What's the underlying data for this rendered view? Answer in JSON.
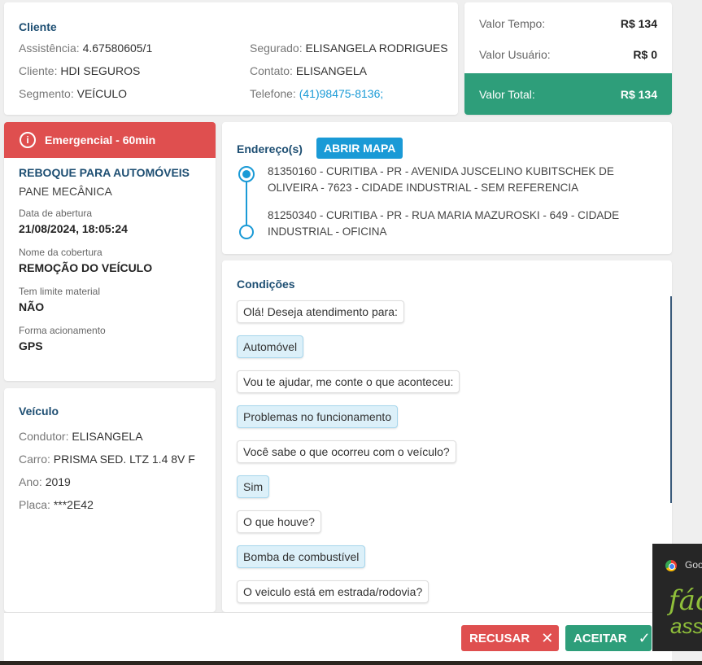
{
  "cliente": {
    "title": "Cliente",
    "assistencia_label": "Assistência:",
    "assistencia": "4.67580605/1",
    "cliente_label": "Cliente:",
    "cliente": "HDI SEGUROS",
    "segmento_label": "Segmento:",
    "segmento": "VEÍCULO",
    "segurado_label": "Segurado:",
    "segurado": "ELISANGELA RODRIGUES",
    "contato_label": "Contato:",
    "contato": "ELISANGELA",
    "telefone_label": "Telefone:",
    "telefone": "(41)98475-8136;"
  },
  "valores": {
    "tempo_label": "Valor Tempo:",
    "tempo": "R$ 134",
    "usuario_label": "Valor Usuário:",
    "usuario": "R$ 0",
    "total_label": "Valor Total:",
    "total": "R$ 134",
    "total_color": "#2e9e7a"
  },
  "servico": {
    "emergencia": "Emergencial - 60min",
    "emergencia_icon": "info-circle-icon",
    "emergencia_color": "#df4f4f",
    "titulo": "REBOQUE PARA AUTOMÓVEIS",
    "subtitulo": "PANE MECÂNICA",
    "abertura_label": "Data de abertura",
    "abertura": "21/08/2024, 18:05:24",
    "cobertura_label": "Nome da cobertura",
    "cobertura": "REMOÇÃO DO VEÍCULO",
    "limite_label": "Tem limite material",
    "limite": "NÃO",
    "acionamento_label": "Forma acionamento",
    "acionamento": "GPS"
  },
  "veiculo": {
    "title": "Veículo",
    "condutor_label": "Condutor:",
    "condutor": "ELISANGELA",
    "carro_label": "Carro:",
    "carro": "PRISMA SED. LTZ 1.4 8V F",
    "ano_label": "Ano:",
    "ano": "2019",
    "placa_label": "Placa:",
    "placa": "***2E42"
  },
  "endereco": {
    "title": "Endereço(s)",
    "mapa_button": "ABRIR MAPA",
    "origem": "81350160 - CURITIBA - PR - AVENIDA JUSCELINO KUBITSCHEK DE OLIVEIRA - 7623 - CIDADE INDUSTRIAL - SEM REFERENCIA",
    "destino": "81250340 - CURITIBA - PR - RUA MARIA MAZUROSKI - 649 - CIDADE INDUSTRIAL - OFICINA"
  },
  "condicoes": {
    "title": "Condições",
    "messages": [
      {
        "text": "Olá! Deseja atendimento para:",
        "type": "question"
      },
      {
        "text": "Automóvel",
        "type": "answer"
      },
      {
        "text": "Vou te ajudar, me conte o que aconteceu:",
        "type": "question"
      },
      {
        "text": "Problemas no funcionamento",
        "type": "answer"
      },
      {
        "text": "Você sabe o que ocorreu com o veículo?",
        "type": "question"
      },
      {
        "text": "Sim",
        "type": "answer"
      },
      {
        "text": "O que houve?",
        "type": "question"
      },
      {
        "text": "Bomba de combustível",
        "type": "answer"
      },
      {
        "text": "O veiculo está em estrada/rodovia?",
        "type": "question"
      }
    ]
  },
  "footer": {
    "recusar": "RECUSAR",
    "recusar_icon": "close-icon",
    "aceitar": "ACEITAR",
    "aceitar_icon": "check-icon"
  },
  "overlay": {
    "app_text": "Goo",
    "logo_line1": "fác",
    "logo_line2": "assi"
  }
}
